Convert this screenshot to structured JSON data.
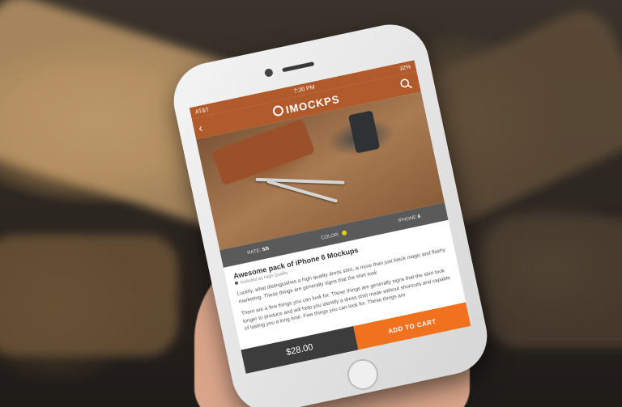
{
  "status": {
    "carrier": "AT&T",
    "time": "7:20 PM",
    "battery": "32%"
  },
  "app": {
    "brand": "IMOCKPS"
  },
  "product": {
    "specs": [
      {
        "label": "RATE:",
        "value": "5/5"
      },
      {
        "label": "COLOR:",
        "value": ""
      },
      {
        "label": "IPHONE",
        "value": "6"
      }
    ],
    "title": "Awesome pack of iPhone 6 Mockups",
    "subtitle": "Included as High Quality",
    "paragraphs": [
      "Luckily, what distinguishes a high quality dress shirt, is more than just black magic and flashy marketing. These things are generally signs that the shirt took",
      "There are a few things you can look for. These things are generally signs that the shirt took longer to produce and will help you identify a dress shirt made without shortcuts and capable of lasting you a long time. Few things you can look for. These things are"
    ],
    "price": "$28.00",
    "cta": "ADD TO CART",
    "accent": "#b15a2c",
    "cta_color": "#f0721f",
    "color_swatch": "#d5d31a"
  }
}
